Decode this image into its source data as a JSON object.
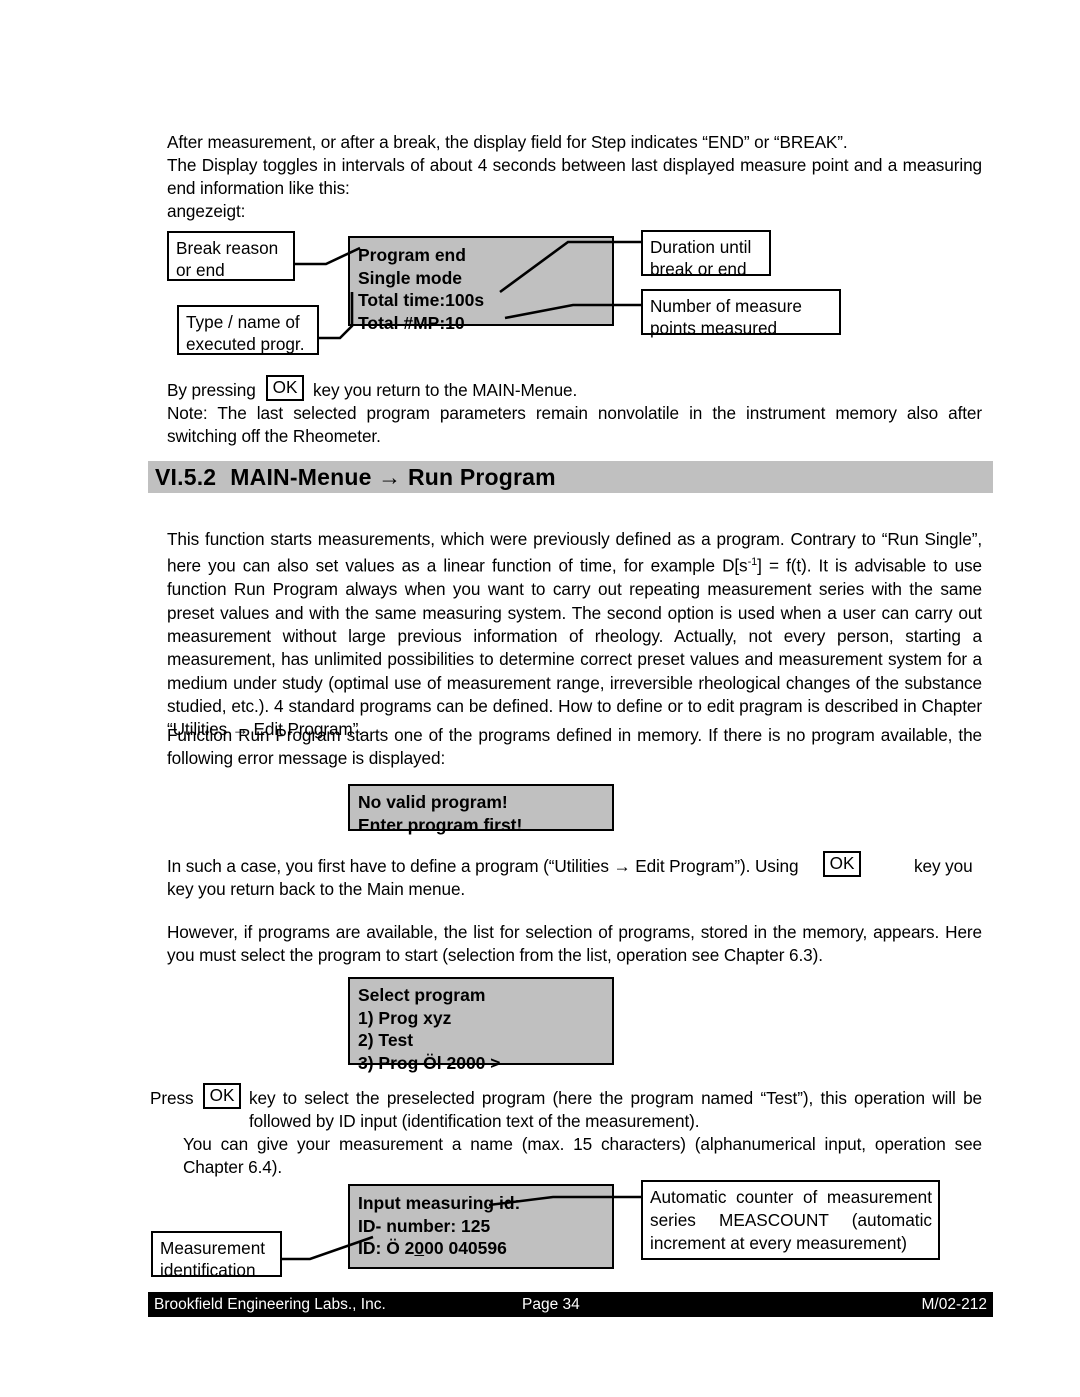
{
  "document": {
    "intro": {
      "line1": "After measurement, or after a break, the display field for Step indicates “END” or “BREAK”.",
      "line2": "The Display toggles in intervals of about 4 seconds between last displayed measure point and a measuring end information like this:",
      "line3": "angezeigt:"
    },
    "diagram_end": {
      "callout_break_reason": "Break reason or end",
      "callout_type_name": "Type / name of executed progr.",
      "callout_duration": "Duration until break or end",
      "callout_num_points": "Number of measure points measured",
      "lcd_lines": [
        "Program end",
        "Single mode",
        "Total time:100s",
        "Total #MP:10"
      ]
    },
    "ok_note": {
      "before_key": "By pressing",
      "ok_label": "OK",
      "after_key": "key you return to the MAIN-Menue.",
      "note": "Note: The last selected program parameters remain nonvolatile in the instrument memory also after switching off the Rheometer."
    },
    "section": {
      "number": "VI.5.2",
      "title": "MAIN-Menue → Run Program"
    },
    "body": {
      "p1_a": "This function starts measurements, which were previously defined as a program. Contrary to “Run Single”, here you can also set values as a linear function of time, for example D[s",
      "p1_exp": "-1",
      "p1_b": "] = f(t). It is advisable to use function Run Program always when you want to carry out repeating measurement series with the same preset values and with the  same measuring system. The second option is used when a user can carry out measurement without large previous information of rheology. Actually, not every person, starting a measurement, has unlimited possibilities to determine correct preset values and measurement system for a medium under study (optimal use of measurement range, irreversible rheological changes of the substance studied, etc.). 4 standard programs can be defined. How to define or to edit pragram is described in Chapter “Utilities → Edit Program”.",
      "p2": "Function Run Program starts one of the programs defined in memory. If there is no program available, the following error message is displayed:",
      "p3_before": "In such a case, you first have to define a program (“Utilities → Edit Program”). Using",
      "p3_ok": "OK",
      "p3_after": "key you return back to the Main menue.",
      "p4": "However, if programs are available, the list for selection of programs, stored in the memory, appears. Here you must select the program to start (selection from the list, operation see Chapter 6.3).",
      "p5_before": "Press",
      "p5_ok": "OK",
      "p5_after": "key to select the preselected program (here the program named “Test”), this operation will be followed by ID input (identification text of the measurement).",
      "p6": "You can give your measurement a name (max. 15 characters) (alphanumerical input, operation see Chapter 6.4)."
    },
    "error_box": {
      "lines": [
        "No valid program!",
        "Enter program first!"
      ]
    },
    "select_box": {
      "lines": [
        "Select program",
        "1) Prog xyz",
        "2) Test",
        "3) Prog Öl 2000 >"
      ]
    },
    "id_diagram": {
      "lcd_lines": [
        "Input measuring id:",
        "ID- number:  125",
        "ID: Ö 2000 040596"
      ],
      "lcd_line3_pre": "ID: Ö 2",
      "lcd_line3_cursor": "0",
      "lcd_line3_post": "00 040596",
      "callout_measurement_id": "Measurement identification",
      "callout_meascount": "Automatic counter of measurement series  MEASCOUNT (automatic increment at every measurement)"
    },
    "footer": {
      "company": "Brookfield Engineering Labs., Inc.",
      "page": "Page 34",
      "docref": "M/02-212"
    },
    "colors": {
      "lcd_gray": "#c0c0c0",
      "heading_gray": "#c0c0c0",
      "footer_bg": "#000000",
      "footer_text": "#ffffff"
    }
  }
}
